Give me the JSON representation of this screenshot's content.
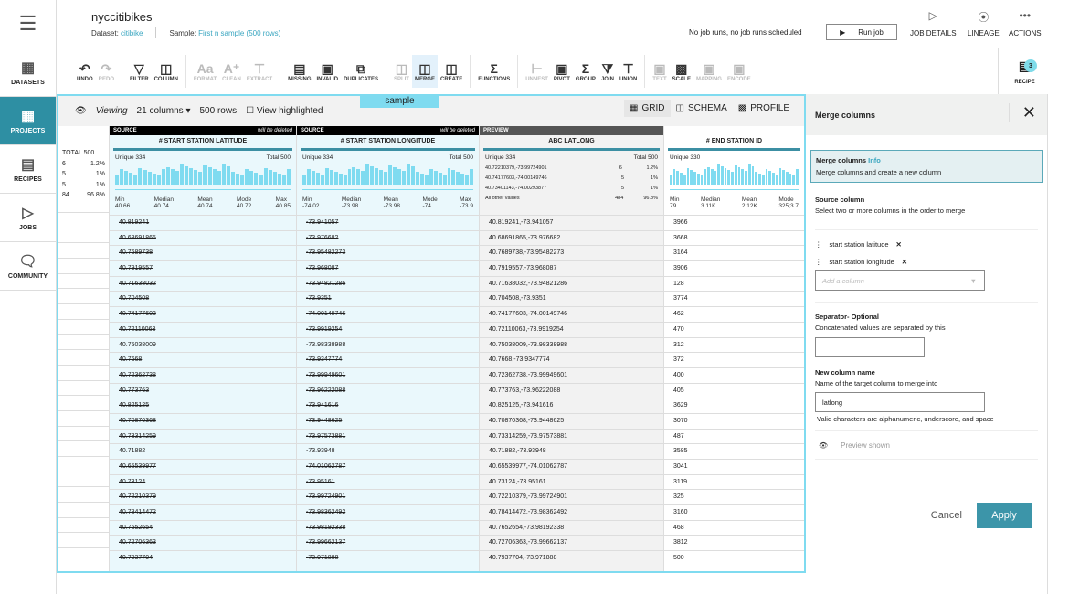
{
  "sidebar": {
    "items": [
      {
        "label": "DATASETS",
        "icon": "table-icon"
      },
      {
        "label": "PROJECTS",
        "icon": "grid-icon",
        "active": true
      },
      {
        "label": "RECIPES",
        "icon": "list-icon"
      },
      {
        "label": "JOBS",
        "icon": "play-icon"
      },
      {
        "label": "COMMUNITY",
        "icon": "chat-icon"
      }
    ]
  },
  "header": {
    "title": "nyccitibikes",
    "dataset_label": "Dataset:",
    "dataset_value": "citibike",
    "sample_label": "Sample:",
    "sample_value": "First n sample (500 rows)",
    "job_status": "No job runs, no job runs scheduled",
    "run_job": "Run job",
    "job_details": "JOB DETAILS",
    "lineage": "LINEAGE",
    "actions": "ACTIONS"
  },
  "toolbar": [
    "UNDO",
    "REDO",
    "FILTER",
    "COLUMN",
    "FORMAT",
    "CLEAN",
    "EXTRACT",
    "MISSING",
    "INVALID",
    "DUPLICATES",
    "SPLIT",
    "MERGE",
    "CREATE",
    "FUNCTIONS",
    "UNNEST",
    "PIVOT",
    "GROUP",
    "JOIN",
    "UNION",
    "TEXT",
    "SCALE",
    "MAPPING",
    "ENCODE"
  ],
  "recipe": {
    "label": "RECIPE",
    "count": "3"
  },
  "viewbar": {
    "viewing": "Viewing",
    "columns": "21 columns",
    "rows": "500 rows",
    "highlight": "View highlighted",
    "sample": "sample",
    "grid": "GRID",
    "schema": "SCHEMA",
    "profile": "PROFILE"
  },
  "summary": {
    "total": "TOTAL 500",
    "rows": [
      [
        "6",
        "1.2%"
      ],
      [
        "5",
        "1%"
      ],
      [
        "5",
        "1%"
      ],
      [
        "84",
        "96.8%"
      ]
    ]
  },
  "columns": [
    {
      "source": "SOURCE",
      "note": "will be deleted",
      "name": "# START STATION LATITUDE",
      "unique": "Unique  334",
      "total": "Total  500",
      "min": "40.66",
      "median": "40.74",
      "mean": "40.74",
      "mode": "40.72",
      "max": "40.85"
    },
    {
      "source": "SOURCE",
      "note": "will be deleted",
      "name": "# START STATION LONGITUDE",
      "unique": "Unique  334",
      "total": "Total  500",
      "min": "-74.02",
      "median": "-73.98",
      "mean": "-73.98",
      "mode": "-74",
      "max": "-73.9"
    },
    {
      "source": "PREVIEW",
      "name": "ABC LATLONG",
      "unique": "Unique  334",
      "total": "Total",
      "total_v": "500",
      "top": [
        [
          "40.72210379,-73.99724901",
          "6",
          "1.2%"
        ],
        [
          "40.74177603,-74.00149746",
          "5",
          "1%"
        ],
        [
          "40.73401143,-74.00293877",
          "5",
          "1%"
        ],
        [
          "All other values",
          "484",
          "96.8%"
        ]
      ]
    },
    {
      "name": "# END STATION ID",
      "unique": "Unique  330",
      "min": "79",
      "median": "3.11K",
      "mean": "2.12K",
      "mode": "325;3.7"
    }
  ],
  "rows": [
    [
      "40.819241",
      "73.941057",
      "40.819241,-73.941057",
      "3966"
    ],
    [
      "40.68691865",
      "73.976682",
      "40.68691865,-73.976682",
      "3668"
    ],
    [
      "40.7689738",
      "73.95482273",
      "40.7689738,-73.95482273",
      "3164"
    ],
    [
      "40.7919557",
      "73.968087",
      "40.7919557,-73.968087",
      "3906"
    ],
    [
      "40.71638032",
      "73.94821286",
      "40.71638032,-73.94821286",
      "128"
    ],
    [
      "40.704508",
      "73.9351",
      "40.704508,-73.9351",
      "3774"
    ],
    [
      "40.74177603",
      "74.00149746",
      "40.74177603,-74.00149746",
      "462"
    ],
    [
      "40.72110063",
      "73.9919254",
      "40.72110063,-73.9919254",
      "470"
    ],
    [
      "40.75038009",
      "73.98338988",
      "40.75038009,-73.98338988",
      "312"
    ],
    [
      "40.7668",
      "73.9347774",
      "40.7668,-73.9347774",
      "372"
    ],
    [
      "40.72362738",
      "73.99949601",
      "40.72362738,-73.99949601",
      "400"
    ],
    [
      "40.773763",
      "73.96222088",
      "40.773763,-73.96222088",
      "405"
    ],
    [
      "40.825125",
      "73.941616",
      "40.825125,-73.941616",
      "3629"
    ],
    [
      "40.70870368",
      "73.9448625",
      "40.70870368,-73.9448625",
      "3070"
    ],
    [
      "40.73314259",
      "73.97573881",
      "40.73314259,-73.97573881",
      "487"
    ],
    [
      "40.71882",
      "73.93948",
      "40.71882,-73.93948",
      "3585"
    ],
    [
      "40.65539977",
      "74.01062787",
      "40.65539977,-74.01062787",
      "3041"
    ],
    [
      "40.73124",
      "73.95161",
      "40.73124,-73.95161",
      "3119"
    ],
    [
      "40.72210379",
      "73.99724901",
      "40.72210379,-73.99724901",
      "325"
    ],
    [
      "40.78414472",
      "73.98362492",
      "40.78414472,-73.98362492",
      "3160"
    ],
    [
      "40.7652654",
      "73.98192338",
      "40.7652654,-73.98192338",
      "468"
    ],
    [
      "40.72706363",
      "73.99662137",
      "40.72706363,-73.99662137",
      "3812"
    ],
    [
      "40.7937704",
      "73.971888",
      "40.7937704,-73.971888",
      "500"
    ]
  ],
  "panel": {
    "title": "Merge columns",
    "info_title": "Merge columns",
    "info_link": "Info",
    "info_desc": "Merge columns and create a new column",
    "source_label": "Source column",
    "source_desc": "Select two or more columns in the order to merge",
    "sources": [
      "start station latitude",
      "start station longitude"
    ],
    "add_placeholder": "Add a column",
    "sep_label": "Separator- Optional",
    "sep_desc": "Concatenated values are separated by this",
    "sep_value": "",
    "name_label": "New column name",
    "name_desc": "Name of the target column to merge into",
    "name_value": "latlong",
    "valid": "Valid characters are alphanumeric, underscore, and space",
    "preview": "Preview shown",
    "cancel": "Cancel",
    "apply": "Apply"
  }
}
